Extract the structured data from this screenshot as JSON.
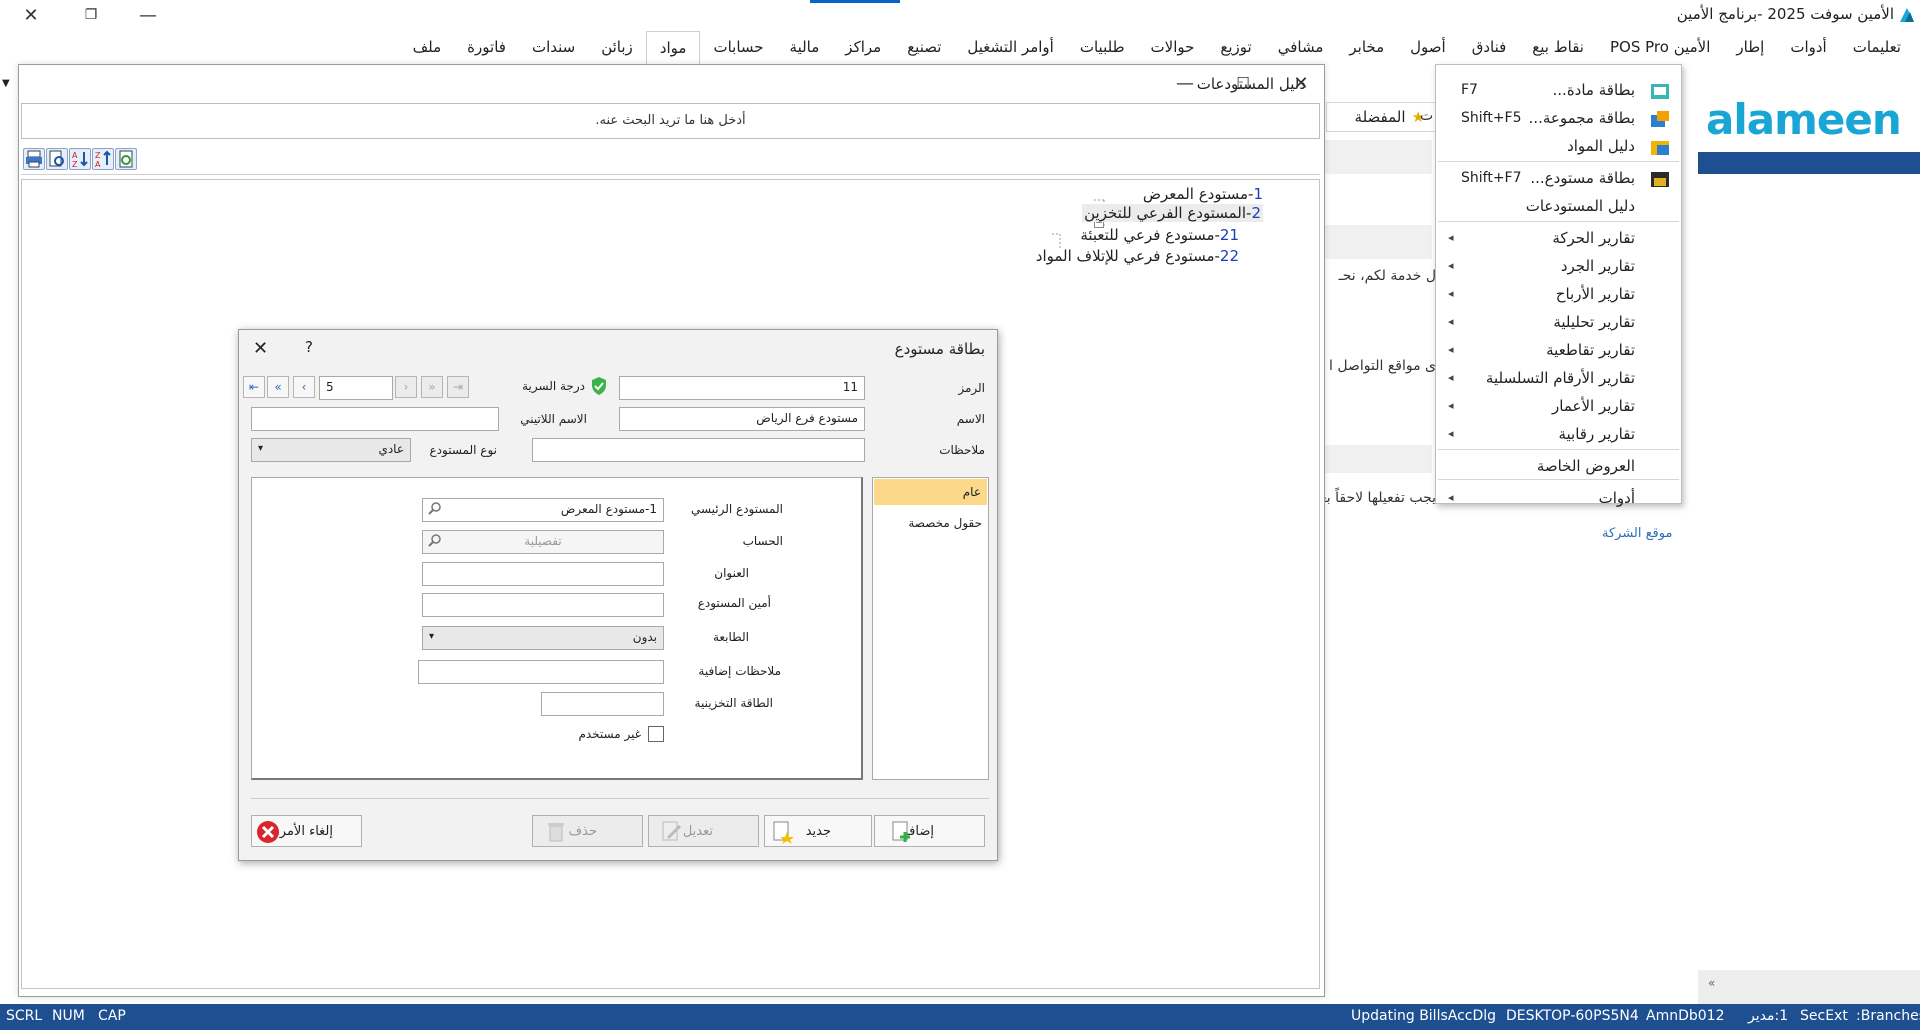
{
  "app": {
    "title": "الأمين سوفت 2025 -برنامج الأمين"
  },
  "menu": {
    "items": [
      "ملف",
      "فاتورة",
      "سندات",
      "زبائن",
      "مواد",
      "حسابات",
      "مالية",
      "مراكز",
      "تصنيع",
      "أوامر التشغيل",
      "طلبيات",
      "حوالات",
      "توزيع",
      "مشافي",
      "مخابر",
      "أصول",
      "فنادق",
      "نقاط بيع",
      "الأمين POS Pro",
      "إطار",
      "أدوات",
      "تعليمات"
    ],
    "active_index": 4
  },
  "dropdown": {
    "rows": [
      {
        "label": "بطاقة مادة...",
        "shortcut": "F7",
        "icon": "material-card-icon"
      },
      {
        "label": "بطاقة مجموعة...",
        "shortcut": "Shift+F5",
        "icon": "group-card-icon"
      },
      {
        "label": "دليل المواد",
        "shortcut": "",
        "icon": "materials-guide-icon"
      },
      {
        "label": "بطاقة مستودع...",
        "shortcut": "Shift+F7",
        "icon": "store-card-icon"
      },
      {
        "label": "دليل المستودعات",
        "shortcut": "",
        "icon": ""
      },
      {
        "label": "تقارير الحركة",
        "submenu": true
      },
      {
        "label": "تقارير الجرد",
        "submenu": true
      },
      {
        "label": "تقارير الأرباح",
        "submenu": true
      },
      {
        "label": "تقارير تحليلية",
        "submenu": true
      },
      {
        "label": "تقارير تقاطعية",
        "submenu": true
      },
      {
        "label": "تقارير الأرقام التسلسلية",
        "submenu": true
      },
      {
        "label": "تقارير الأعمار",
        "submenu": true
      },
      {
        "label": "تقارير رقابية",
        "submenu": true
      },
      {
        "label": "العروض الخاصة",
        "submenu": false
      },
      {
        "label": "أدوات",
        "submenu": true
      }
    ]
  },
  "home": {
    "favorites": "المفضلة",
    "tab_fragment": "ت",
    "line1": "ل خدمة لكم، نحـ",
    "line2": "ى مواقع التواصل ا",
    "line3": "يجب تفعيلها لاحقاً بعد تلقي الشركة مع تفعيل خيار ا",
    "company_link": "موقع الشركة"
  },
  "logo": {
    "text": "alameen"
  },
  "stores_window": {
    "title": "دليل المستودعات",
    "search_placeholder": "أدخل هنا ما تريد البحث عنه.",
    "tree": [
      {
        "num": "1",
        "name": "-مستودع المعرض"
      },
      {
        "num": "2",
        "name": "-المستودع الفرعي للتخزين"
      },
      {
        "num": "21",
        "name": "-مستودع فرعي للتعبئة"
      },
      {
        "num": "22",
        "name": "-مستودع فرعي للإتلاف المواد"
      }
    ]
  },
  "card": {
    "title": "بطاقة مستودع",
    "help": "?",
    "code_label": "الرمز",
    "code_value": "11",
    "secrecy_label": "درجة السرية",
    "nav_value": "5",
    "name_label": "الاسم",
    "name_value": "مستودع فرع الرياض",
    "latin_label": "الاسم اللاتيني",
    "latin_value": "",
    "notes_label": "ملاحظات",
    "notes_value": "",
    "type_label": "نوع المستودع",
    "type_value": "عادي",
    "tabs": [
      "عام",
      "حقول مخصصة"
    ],
    "general": {
      "main_store_label": "المستودع الرئيسي",
      "main_store_value": "1-مستودع المعرض",
      "account_label": "الحساب",
      "account_placeholder": "تفصيلية",
      "address_label": "العنوان",
      "keeper_label": "أمين المستودع",
      "printer_label": "الطابعة",
      "printer_value": "بدون",
      "extra_notes_label": "ملاحظات إضافية",
      "capacity_label": "الطاقة التخزينية",
      "unused_label": "غير مستخدم"
    },
    "buttons": {
      "add": "إضافة",
      "new": "جديد",
      "edit": "تعديل",
      "delete": "حذف",
      "cancel": "إلغاء الأمر"
    }
  },
  "status": {
    "left": [
      "SCRL",
      "NUM",
      "CAP"
    ],
    "updating": "Updating BillsAccDlg",
    "machine": "DESKTOP-60PS5N4",
    "db": "AmnDb012",
    "user": "1:مدير",
    "secext": "SecExt",
    "branches": ":Branches"
  },
  "colors": {
    "accent": "#1d4f91",
    "logo": "#1aa6d4",
    "selected_tab": "#fbd88a",
    "tree_num": "#1a3fb5"
  }
}
